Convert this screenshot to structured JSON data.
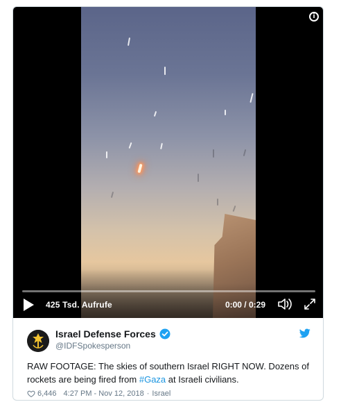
{
  "player": {
    "info_icon": "info-icon",
    "views": "425 Tsd. Aufrufe",
    "time": "0:00 / 0:29",
    "progress": 0,
    "icons": [
      "play-icon",
      "volume-icon",
      "fullscreen-icon"
    ]
  },
  "tweet": {
    "display_name": "Israel Defense Forces",
    "handle": "@IDFSpokesperson",
    "verified": true,
    "text_part1": "RAW FOOTAGE: The skies of southern Israel RIGHT NOW. Dozens of rockets are being fired from ",
    "hashtag": "#Gaza",
    "text_part2": " at Israeli civilians.",
    "likes": "6,446",
    "timestamp": "4:27 PM - Nov 12, 2018",
    "separator": "·",
    "location": "Israel"
  },
  "colors": {
    "link": "#1b95e0",
    "text": "#14171a",
    "muted": "#657786",
    "verified": "#1da1f2",
    "border": "#cfd9de"
  }
}
